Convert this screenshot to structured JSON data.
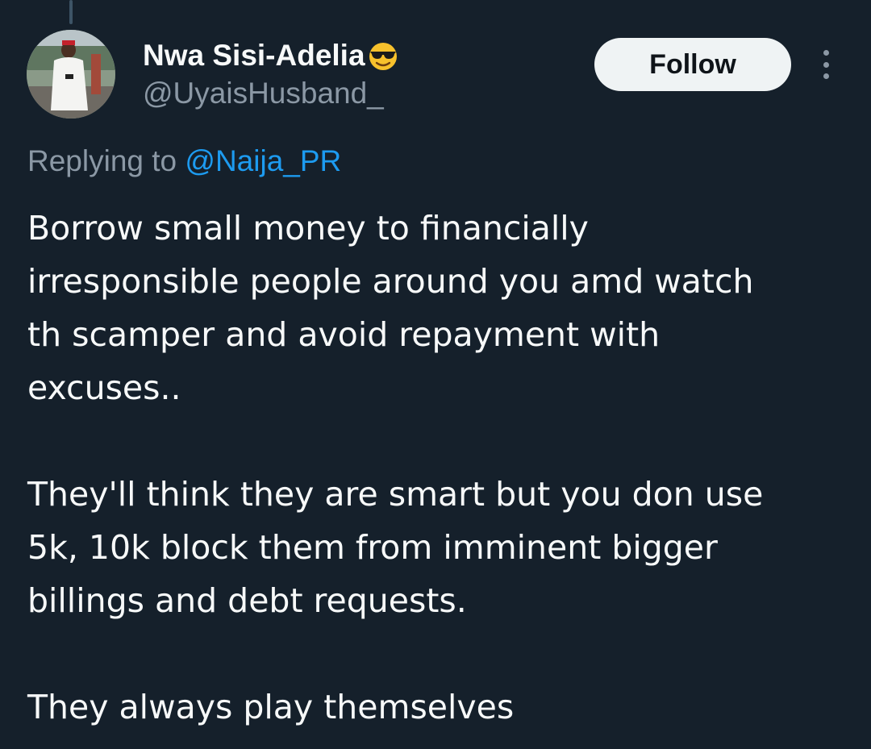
{
  "user": {
    "display_name": "Nwa Sisi-Adelia",
    "name_emoji": "smiling-face-with-sunglasses-icon",
    "handle": "@UyaisHusband_"
  },
  "actions": {
    "follow_label": "Follow",
    "more_icon": "more-vertical-icon"
  },
  "reply": {
    "prefix": "Replying to",
    "target": "@Naija_PR"
  },
  "tweet": {
    "paragraphs": [
      "Borrow small money to financially\nirresponsible people around you amd watch\nth scamper and avoid repayment with\nexcuses..",
      "They'll think they are smart but you don use\n5k, 10k block them from imminent bigger\nbillings and debt requests.",
      "They always play themselves"
    ]
  },
  "colors": {
    "background": "#15202b",
    "text_primary": "#f7f9f9",
    "text_secondary": "#8b98a5",
    "link": "#1d9bf0",
    "follow_button_bg": "#eff3f4"
  }
}
